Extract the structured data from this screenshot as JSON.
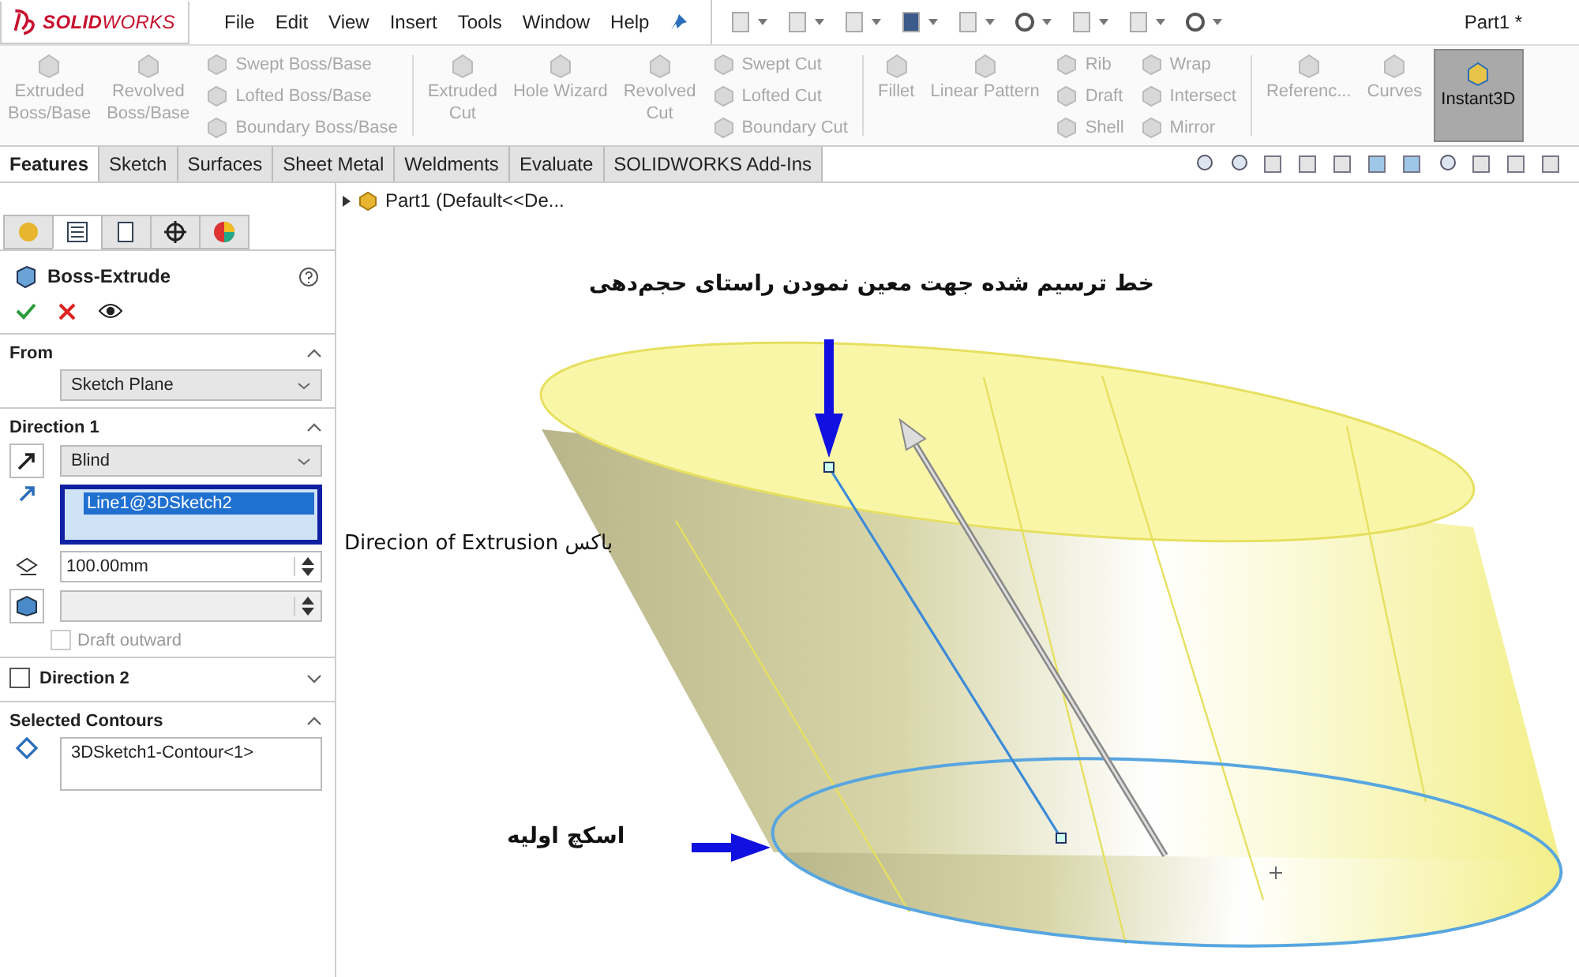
{
  "app": {
    "logo": "**SOLID**WORKS",
    "menu": [
      "File",
      "Edit",
      "View",
      "Insert",
      "Tools",
      "Window",
      "Help"
    ],
    "document_title": "Part1 *"
  },
  "ribbon": {
    "groups": [
      {
        "columns": [
          {
            "kind": "large",
            "items": [
              {
                "label": "Extruded\nBoss/Base",
                "disabled": true,
                "on": false
              }
            ]
          },
          {
            "kind": "large",
            "items": [
              {
                "label": "Revolved\nBoss/Base",
                "disabled": true,
                "on": false
              }
            ]
          },
          {
            "kind": "stack",
            "items": [
              {
                "label": "Swept Boss/Base",
                "disabled": true,
                "on": false
              },
              {
                "label": "Lofted Boss/Base",
                "disabled": true,
                "on": false
              },
              {
                "label": "Boundary Boss/Base",
                "disabled": true,
                "on": false
              }
            ]
          }
        ]
      },
      {
        "columns": [
          {
            "kind": "large",
            "items": [
              {
                "label": "Extruded\nCut",
                "disabled": true,
                "on": false
              }
            ]
          },
          {
            "kind": "large",
            "items": [
              {
                "label": "Hole Wizard",
                "disabled": true,
                "on": false
              }
            ]
          },
          {
            "kind": "large",
            "items": [
              {
                "label": "Revolved\nCut",
                "disabled": true,
                "on": false
              }
            ]
          },
          {
            "kind": "stack",
            "items": [
              {
                "label": "Swept Cut",
                "disabled": true,
                "on": false
              },
              {
                "label": "Lofted Cut",
                "disabled": true,
                "on": false
              },
              {
                "label": "Boundary Cut",
                "disabled": true,
                "on": false
              }
            ]
          }
        ]
      },
      {
        "columns": [
          {
            "kind": "large",
            "items": [
              {
                "label": "Fillet",
                "disabled": true,
                "on": false
              }
            ]
          },
          {
            "kind": "large",
            "items": [
              {
                "label": "Linear Pattern",
                "disabled": true,
                "on": false
              }
            ]
          },
          {
            "kind": "stack",
            "items": [
              {
                "label": "Rib",
                "disabled": true,
                "on": false
              },
              {
                "label": "Draft",
                "disabled": true,
                "on": false
              },
              {
                "label": "Shell",
                "disabled": true,
                "on": false
              }
            ]
          },
          {
            "kind": "stack",
            "items": [
              {
                "label": "Wrap",
                "disabled": true,
                "on": false
              },
              {
                "label": "Intersect",
                "disabled": true,
                "on": false
              },
              {
                "label": "Mirror",
                "disabled": true,
                "on": false
              }
            ]
          }
        ]
      },
      {
        "columns": [
          {
            "kind": "large",
            "items": [
              {
                "label": "Referenc...",
                "disabled": true,
                "on": false
              }
            ]
          },
          {
            "kind": "large",
            "items": [
              {
                "label": "Curves",
                "disabled": true,
                "on": false
              }
            ]
          },
          {
            "kind": "large",
            "items": [
              {
                "label": "Instant3D",
                "disabled": false,
                "on": true
              }
            ]
          }
        ]
      }
    ]
  },
  "command_tabs": [
    {
      "label": "Features",
      "selected": true
    },
    {
      "label": "Sketch",
      "selected": false
    },
    {
      "label": "Surfaces",
      "selected": false
    },
    {
      "label": "Sheet Metal",
      "selected": false
    },
    {
      "label": "Weldments",
      "selected": false
    },
    {
      "label": "Evaluate",
      "selected": false
    },
    {
      "label": "SOLIDWORKS Add-Ins",
      "selected": false
    }
  ],
  "panel_tabs": [
    {
      "selected": false
    },
    {
      "selected": true
    },
    {
      "selected": false
    },
    {
      "selected": false
    },
    {
      "selected": false
    }
  ],
  "property_manager": {
    "title": "Boss-Extrude",
    "sections": [
      {
        "kind": "from",
        "title": "From",
        "expanded": true,
        "start": "Sketch Plane"
      },
      {
        "kind": "direction",
        "title": "Direction 1",
        "expanded": true,
        "end_condition": "Blind",
        "list_active": true,
        "direction_items": [
          {
            "label": "Line1@3DSketch2",
            "selected": true
          }
        ],
        "depth": "100.00mm",
        "draft_outward": {
          "label": "Draft outward",
          "checked": false,
          "disabled": true
        }
      },
      {
        "kind": "direction2",
        "title": "Direction 2",
        "checked": false,
        "expanded": false
      },
      {
        "kind": "contours",
        "title": "Selected Contours",
        "expanded": true,
        "items": [
          "3DSketch1-Contour<1>"
        ]
      }
    ]
  },
  "tree_flyout": {
    "label": "Part1  (Default<<De..."
  },
  "annotations": [
    {
      "kind": "top",
      "text": "خط ترسیم شده جهت معین نمودن راستای حجم‌دهی"
    },
    {
      "kind": "side",
      "text": "Direcion of Extrusion باکس"
    },
    {
      "kind": "bottom",
      "text": "اسکچ اولیه"
    }
  ]
}
